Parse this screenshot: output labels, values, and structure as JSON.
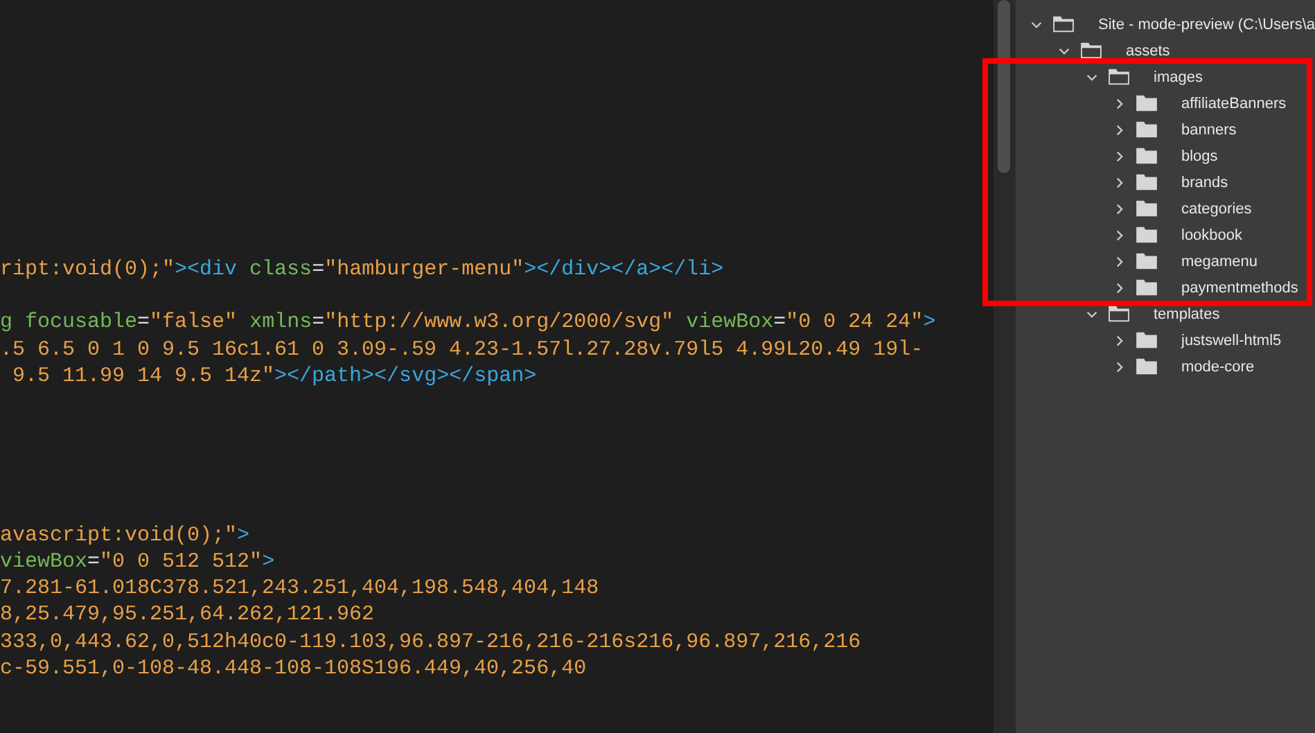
{
  "editor": {
    "lines": [
      {
        "kind": "code",
        "tokens": [
          {
            "kind": "string",
            "text": "ript:void(0);\""
          },
          {
            "kind": "tag",
            "text": "><div"
          },
          {
            "kind": "attr",
            "text": " class"
          },
          {
            "kind": "plain",
            "text": "="
          },
          {
            "kind": "string",
            "text": "\"hamburger-menu\""
          },
          {
            "kind": "tag",
            "text": "></div></a></li>"
          }
        ]
      },
      {
        "kind": "blank"
      },
      {
        "kind": "code",
        "tokens": [
          {
            "kind": "attr",
            "text": "g focusable"
          },
          {
            "kind": "plain",
            "text": "="
          },
          {
            "kind": "string",
            "text": "\"false\""
          },
          {
            "kind": "attr",
            "text": " xmlns"
          },
          {
            "kind": "plain",
            "text": "="
          },
          {
            "kind": "string",
            "text": "\"http://www.w3.org/2000/svg\""
          },
          {
            "kind": "attr",
            "text": " viewBox"
          },
          {
            "kind": "plain",
            "text": "="
          },
          {
            "kind": "string",
            "text": "\"0 0 24 24\""
          },
          {
            "kind": "tag",
            "text": ">"
          }
        ]
      },
      {
        "kind": "code",
        "tokens": [
          {
            "kind": "string",
            "text": ".5 6.5 0 1 0 9.5 16c1.61 0 3.09-.59 4.23-1.57l.27.28v.79l5 4.99L20.49 19l-"
          }
        ]
      },
      {
        "kind": "code",
        "tokens": [
          {
            "kind": "string",
            "text": " 9.5 11.99 14 9.5 14z\""
          },
          {
            "kind": "tag",
            "text": "></path></svg></span>"
          }
        ]
      },
      {
        "kind": "blank"
      },
      {
        "kind": "blank"
      },
      {
        "kind": "blank"
      },
      {
        "kind": "blank"
      },
      {
        "kind": "blank"
      },
      {
        "kind": "code",
        "tokens": [
          {
            "kind": "string",
            "text": "avascript:void(0);\""
          },
          {
            "kind": "tag",
            "text": ">"
          }
        ]
      },
      {
        "kind": "code",
        "tokens": [
          {
            "kind": "attr",
            "text": "viewBox"
          },
          {
            "kind": "plain",
            "text": "="
          },
          {
            "kind": "string",
            "text": "\"0 0 512 512\""
          },
          {
            "kind": "tag",
            "text": ">"
          }
        ]
      },
      {
        "kind": "code",
        "tokens": [
          {
            "kind": "string",
            "text": "7.281-61.018C378.521,243.251,404,198.548,404,148"
          }
        ]
      },
      {
        "kind": "code",
        "tokens": [
          {
            "kind": "string",
            "text": "8,25.479,95.251,64.262,121.962"
          }
        ]
      },
      {
        "kind": "code",
        "tokens": [
          {
            "kind": "string",
            "text": "333,0,443.62,0,512h40c0-119.103,96.897-216,216-216s216,96.897,216,216"
          }
        ]
      },
      {
        "kind": "code",
        "tokens": [
          {
            "kind": "string",
            "text": "c-59.551,0-108-48.448-108-108S196.449,40,256,40"
          }
        ]
      }
    ]
  },
  "file_tree": [
    {
      "label": "Site - mode-preview (C:\\Users\\a",
      "expanded": true,
      "children": [
        {
          "label": "assets",
          "expanded": true,
          "children": [
            {
              "label": "images",
              "expanded": true,
              "highlighted": true,
              "children": [
                {
                  "label": "affiliateBanners",
                  "expanded": false
                },
                {
                  "label": "banners",
                  "expanded": false
                },
                {
                  "label": "blogs",
                  "expanded": false
                },
                {
                  "label": "brands",
                  "expanded": false
                },
                {
                  "label": "categories",
                  "expanded": false
                },
                {
                  "label": "lookbook",
                  "expanded": false
                },
                {
                  "label": "megamenu",
                  "expanded": false
                },
                {
                  "label": "paymentmethods",
                  "expanded": false
                }
              ]
            },
            {
              "label": "templates",
              "expanded": true,
              "children": [
                {
                  "label": "justswell-html5",
                  "expanded": false
                },
                {
                  "label": "mode-core",
                  "expanded": false
                }
              ]
            }
          ]
        }
      ]
    }
  ]
}
